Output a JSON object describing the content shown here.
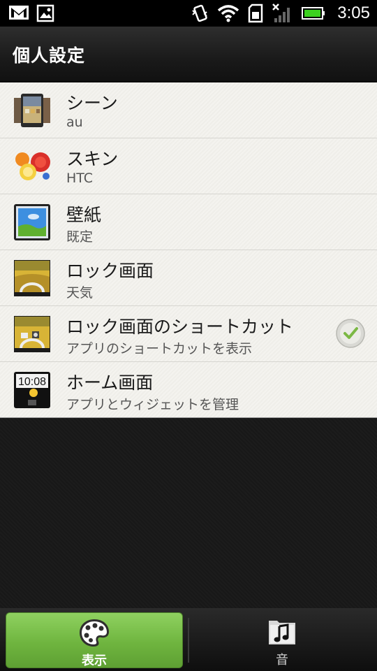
{
  "status_bar": {
    "time": "3:05",
    "icons": [
      "gmail-icon",
      "image-icon",
      "vibrate-icon",
      "wifi-icon",
      "sd-card-icon",
      "no-signal-icon",
      "battery-icon"
    ],
    "battery_color": "#3cd11f"
  },
  "header": {
    "title": "個人設定"
  },
  "settings": {
    "items": [
      {
        "title": "シーン",
        "subtitle": "au",
        "icon": "scene-icon"
      },
      {
        "title": "スキン",
        "subtitle": "HTC",
        "icon": "skin-icon"
      },
      {
        "title": "壁紙",
        "subtitle": "既定",
        "icon": "wallpaper-icon"
      },
      {
        "title": "ロック画面",
        "subtitle": "天気",
        "icon": "lock-screen-icon"
      },
      {
        "title": "ロック画面のショートカット",
        "subtitle": "アプリのショートカットを表示",
        "icon": "lock-shortcut-icon",
        "checked": true
      },
      {
        "title": "ホーム画面",
        "subtitle": "アプリとウィジェットを管理",
        "icon": "home-screen-icon",
        "clock": "10:08"
      }
    ]
  },
  "tabs": [
    {
      "label": "表示",
      "icon": "palette-icon",
      "selected": true
    },
    {
      "label": "音",
      "icon": "music-note-icon",
      "selected": false
    }
  ],
  "colors": {
    "accent": "#6fb53f",
    "check": "#7bb844"
  }
}
